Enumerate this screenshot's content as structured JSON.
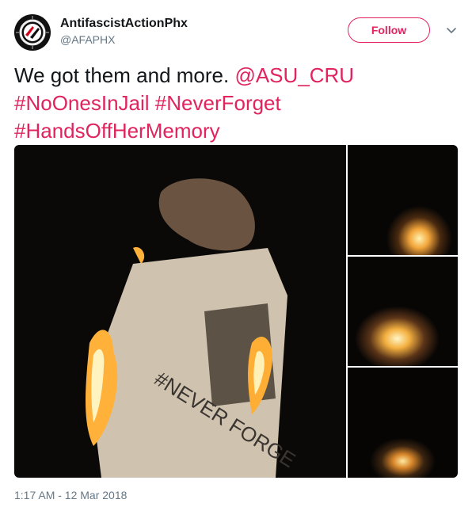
{
  "author": {
    "display_name": "AntifascistActionPhx",
    "handle": "@AFAPHX",
    "avatar_icon": "antifa-logo-icon"
  },
  "follow_label": "Follow",
  "menu_icon": "chevron-down-icon",
  "tweet": {
    "text_plain": "We got them and more. ",
    "mention": "@ASU_CRU",
    "hashtag1": "#NoOnesInJail",
    "hashtag2": "#NeverForget",
    "hashtag3": "#HandsOffHerMemory"
  },
  "media": {
    "main_overlay_text": "#NEVER FORGE"
  },
  "timestamp": "1:17 AM - 12 Mar 2018",
  "colors": {
    "accent": "#e0245e",
    "text": "#14171a",
    "muted": "#657786"
  }
}
